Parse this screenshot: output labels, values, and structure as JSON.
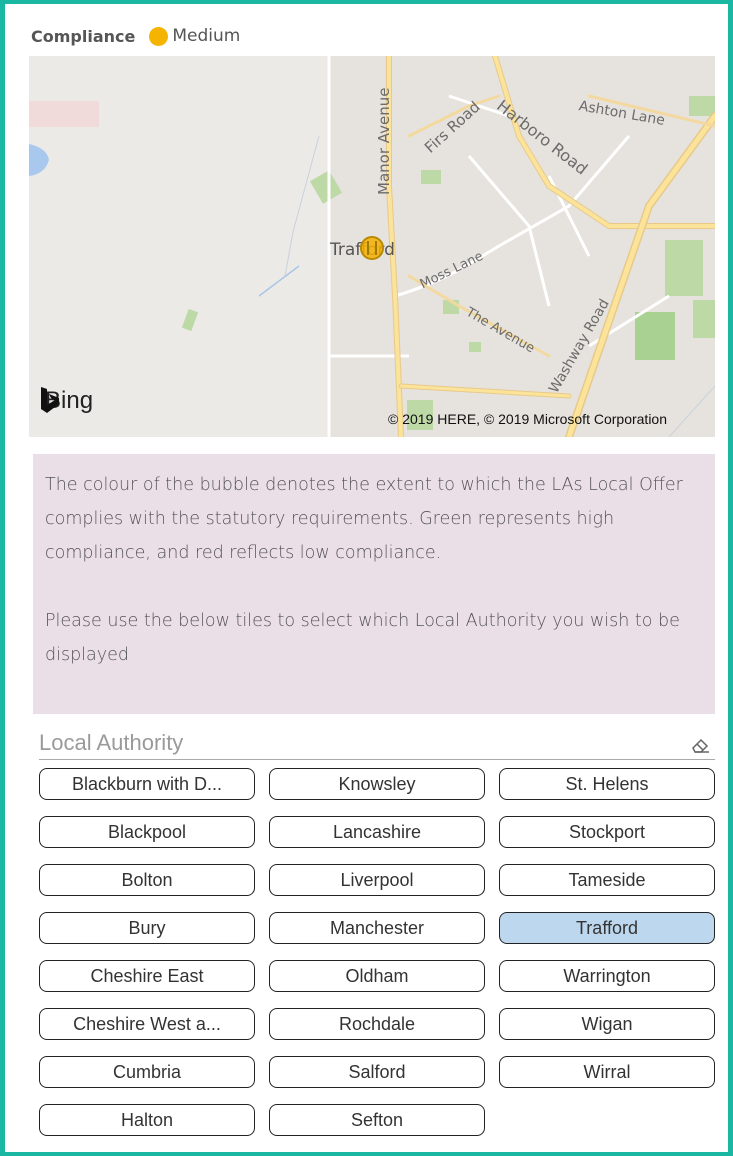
{
  "legend": {
    "title": "Compliance",
    "item_label": "Medium",
    "item_color": "#f5b400"
  },
  "map": {
    "provider": "Bing",
    "copyright": "© 2019 HERE, © 2019 Microsoft Corporation",
    "place_label": "Trafford",
    "roads": {
      "manor": "Manor Avenue",
      "firs": "Firs Road",
      "harboro": "Harboro Road",
      "ashton": "Ashton Lane",
      "moss": "Moss Lane",
      "avenue": "The Avenue",
      "washway": "Washway Road"
    },
    "bubble_color": "#f5b400"
  },
  "info": {
    "paragraph1": "The colour of the bubble denotes the extent to which the LAs Local Offer complies with the statutory requirements. Green represents high compliance, and red reflects low compliance.",
    "paragraph2": "Please use the below tiles to select which Local Authority you wish to be displayed"
  },
  "slicer": {
    "title": "Local Authority",
    "selected": "Trafford",
    "tiles": [
      "Blackburn with D...",
      "Knowsley",
      "St. Helens",
      "Blackpool",
      "Lancashire",
      "Stockport",
      "Bolton",
      "Liverpool",
      "Tameside",
      "Bury",
      "Manchester",
      "Trafford",
      "Cheshire East",
      "Oldham",
      "Warrington",
      "Cheshire West a...",
      "Rochdale",
      "Wigan",
      "Cumbria",
      "Salford",
      "Wirral",
      "Halton",
      "Sefton"
    ]
  },
  "colors": {
    "frame": "#1ab8a3",
    "info_background": "#ebdfe7",
    "selected_tile": "#bdd7ee"
  }
}
